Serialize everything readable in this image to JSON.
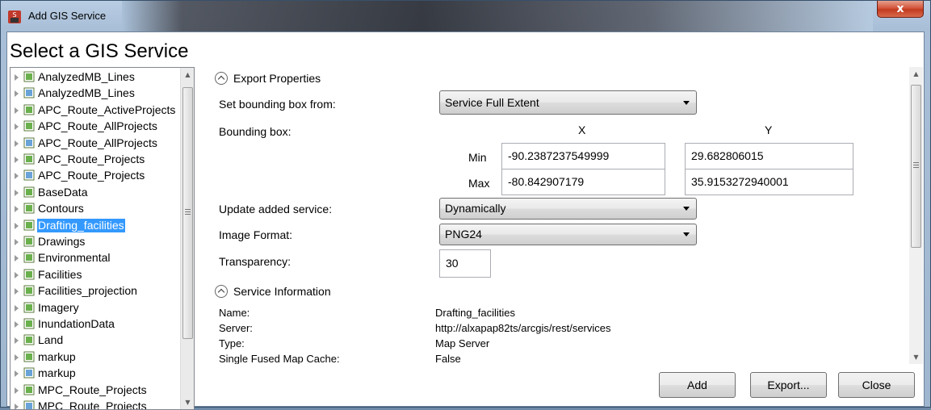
{
  "window": {
    "title": "Add GIS Service",
    "close_glyph": "x"
  },
  "heading": "Select a GIS Service",
  "tree": {
    "items": [
      {
        "label": "AnalyzedMB_Lines",
        "icon": "green-layer-icon",
        "selected": false
      },
      {
        "label": "AnalyzedMB_Lines",
        "icon": "globe-layer-icon",
        "selected": false
      },
      {
        "label": "APC_Route_ActiveProjects",
        "icon": "green-layer-icon",
        "selected": false
      },
      {
        "label": "APC_Route_AllProjects",
        "icon": "green-layer-icon",
        "selected": false
      },
      {
        "label": "APC_Route_AllProjects",
        "icon": "globe-layer-icon",
        "selected": false
      },
      {
        "label": "APC_Route_Projects",
        "icon": "green-layer-icon",
        "selected": false
      },
      {
        "label": "APC_Route_Projects",
        "icon": "globe-layer-icon",
        "selected": false
      },
      {
        "label": "BaseData",
        "icon": "green-layer-icon",
        "selected": false
      },
      {
        "label": "Contours",
        "icon": "green-layer-icon",
        "selected": false
      },
      {
        "label": "Drafting_facilities",
        "icon": "green-layer-icon",
        "selected": true
      },
      {
        "label": "Drawings",
        "icon": "green-layer-icon",
        "selected": false
      },
      {
        "label": "Environmental",
        "icon": "green-layer-icon",
        "selected": false
      },
      {
        "label": "Facilities",
        "icon": "green-layer-icon",
        "selected": false
      },
      {
        "label": "Facilities_projection",
        "icon": "green-layer-icon",
        "selected": false
      },
      {
        "label": "Imagery",
        "icon": "green-layer-icon",
        "selected": false
      },
      {
        "label": "InundationData",
        "icon": "green-layer-icon",
        "selected": false
      },
      {
        "label": "Land",
        "icon": "green-layer-icon",
        "selected": false
      },
      {
        "label": "markup",
        "icon": "green-layer-icon",
        "selected": false
      },
      {
        "label": "markup",
        "icon": "globe-layer-icon",
        "selected": false
      },
      {
        "label": "MPC_Route_Projects",
        "icon": "green-layer-icon",
        "selected": false
      },
      {
        "label": "MPC_Route_Projects",
        "icon": "globe-layer-icon",
        "selected": false
      }
    ]
  },
  "export": {
    "section_title": "Export Properties",
    "bbox_from_label": "Set bounding box from:",
    "bbox_from_value": "Service Full Extent",
    "bbox_label": "Bounding box:",
    "x_header": "X",
    "y_header": "Y",
    "min_label": "Min",
    "max_label": "Max",
    "min_x": "-90.2387237549999",
    "min_y": "29.682806015",
    "max_x": "-80.842907179",
    "max_y": "35.9153272940001",
    "update_label": "Update added service:",
    "update_value": "Dynamically",
    "format_label": "Image Format:",
    "format_value": "PNG24",
    "transparency_label": "Transparency:",
    "transparency_value": "30"
  },
  "service_info": {
    "section_title": "Service Information",
    "name_label": "Name:",
    "name_value": "Drafting_facilities",
    "server_label": "Server:",
    "server_value": "http://alxapap82ts/arcgis/rest/services",
    "type_label": "Type:",
    "type_value": "Map Server",
    "cache_label": "Single Fused Map Cache:",
    "cache_value": "False"
  },
  "buttons": {
    "add": "Add",
    "export": "Export...",
    "close": "Close"
  }
}
